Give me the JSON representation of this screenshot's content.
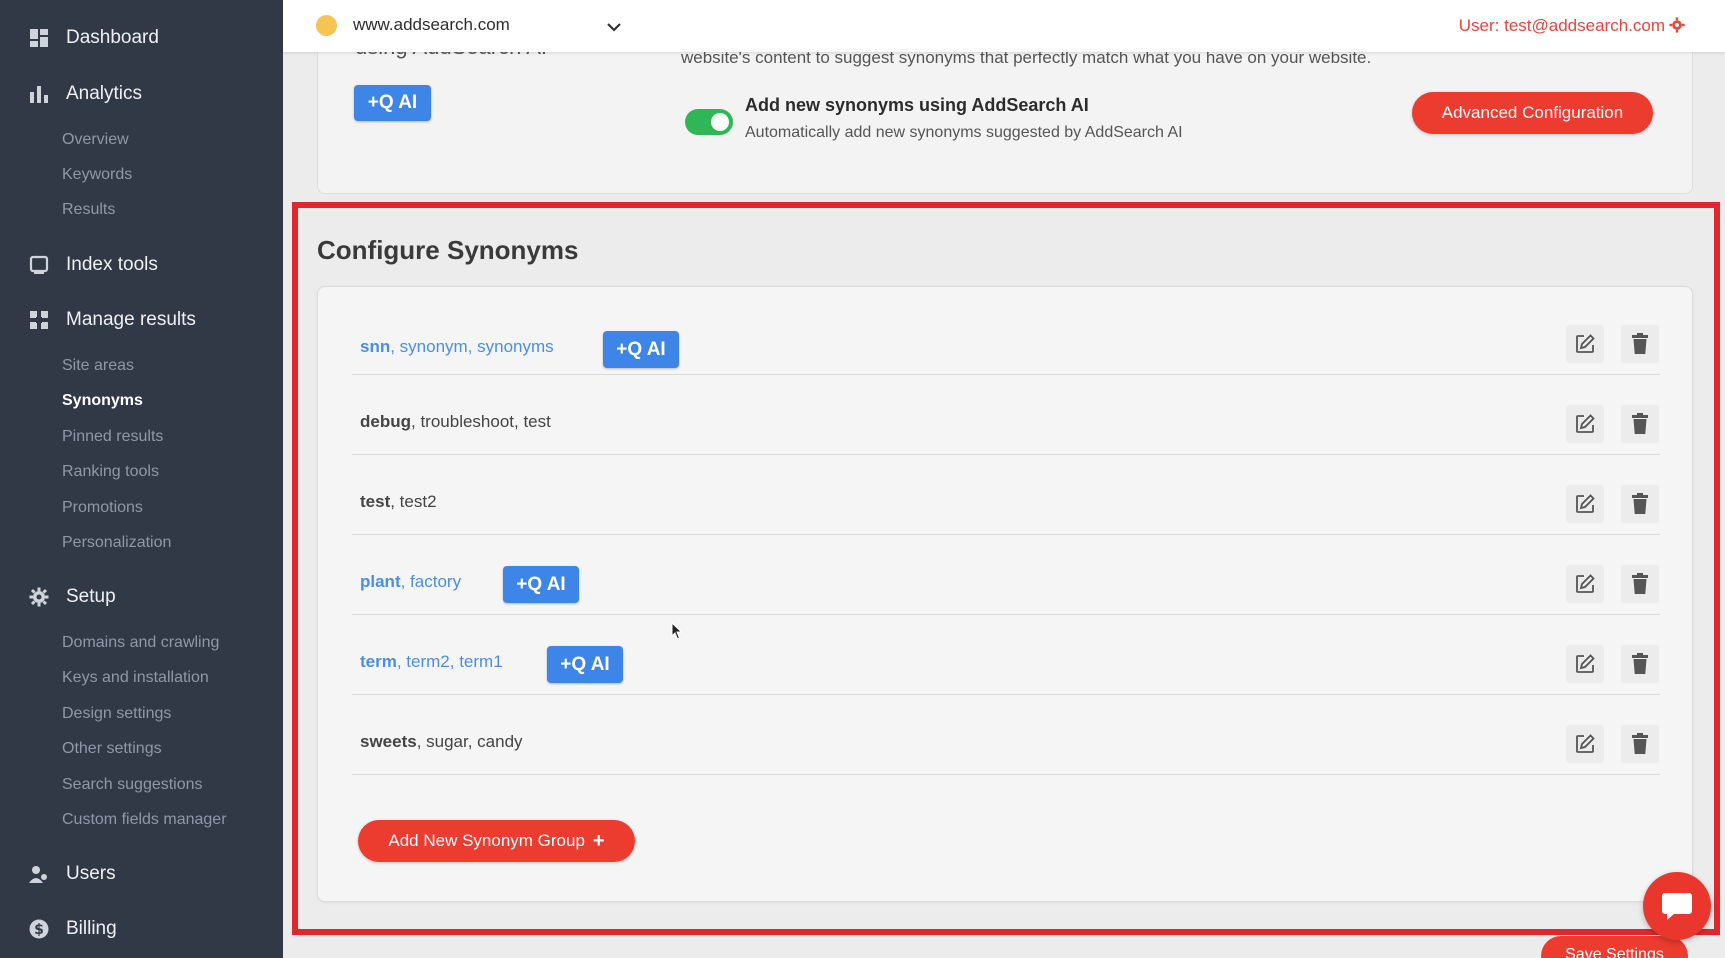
{
  "sidebar": {
    "items": [
      {
        "label": "Dashboard",
        "icon": "dashboard-icon"
      },
      {
        "label": "Analytics",
        "icon": "bar-chart-icon",
        "children": [
          "Overview",
          "Keywords",
          "Results"
        ]
      },
      {
        "label": "Index tools",
        "icon": "index-icon"
      },
      {
        "label": "Manage results",
        "icon": "manage-icon",
        "children": [
          "Site areas",
          "Synonyms",
          "Pinned results",
          "Ranking tools",
          "Promotions",
          "Personalization"
        ]
      },
      {
        "label": "Setup",
        "icon": "gear-icon",
        "children": [
          "Domains and crawling",
          "Keys and installation",
          "Design settings",
          "Other settings",
          "Search suggestions",
          "Custom fields manager"
        ]
      },
      {
        "label": "Users",
        "icon": "users-icon"
      },
      {
        "label": "Billing",
        "icon": "dollar-icon"
      }
    ],
    "active_subitem": "Synonyms"
  },
  "topbar": {
    "domain": "www.addsearch.com",
    "user": "User: test@addsearch.com"
  },
  "ai_card": {
    "heading_partial": "using AddSearch AI",
    "description_partial": "website's content to suggest synonyms that perfectly match what you have on your website.",
    "ai_badge": "+Q AI",
    "toggle_on": true,
    "toggle_title": "Add new synonyms using AddSearch AI",
    "toggle_sub": "Automatically add new synonyms suggested by AddSearch AI",
    "advanced_button": "Advanced Configuration"
  },
  "synonyms": {
    "title": "Configure Synonyms",
    "rows": [
      {
        "primary": "snn",
        "rest": ", synonym, synonyms",
        "ai": true
      },
      {
        "primary": "debug",
        "rest": ", troubleshoot, test",
        "ai": false
      },
      {
        "primary": "test",
        "rest": ", test2",
        "ai": false
      },
      {
        "primary": "plant",
        "rest": ", factory",
        "ai": true
      },
      {
        "primary": "term",
        "rest": ", term2, term1",
        "ai": true
      },
      {
        "primary": "sweets",
        "rest": ", sugar, candy",
        "ai": false
      }
    ],
    "ai_badge": "+Q AI",
    "add_button": "Add New Synonym Group"
  },
  "save_button": "Save Settings",
  "colors": {
    "sidebar_bg": "#323946",
    "accent_red": "#ec3b2f",
    "ai_blue": "#3d86e8",
    "toggle_green": "#2fb757",
    "highlight_red": "#e3262b"
  }
}
